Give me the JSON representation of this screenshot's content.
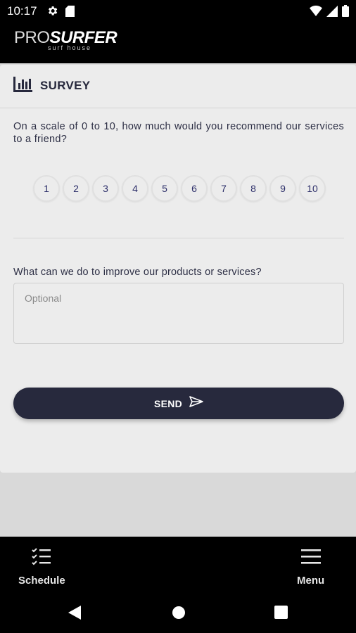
{
  "status_bar": {
    "time": "10:17",
    "icons_left": [
      "gear-icon",
      "sd-card-icon"
    ],
    "icons_right": [
      "wifi-icon",
      "signal-icon",
      "battery-icon"
    ]
  },
  "header": {
    "logo_pro": "PRO",
    "logo_surfer": "SURFER",
    "logo_sub": "surf house"
  },
  "survey": {
    "title": "SURVEY",
    "question": "On a scale of 0 to 10, how much would you recommend our services to a friend?",
    "scale": [
      "1",
      "2",
      "3",
      "4",
      "5",
      "6",
      "7",
      "8",
      "9",
      "10"
    ],
    "improve_label": "What can we do to improve our products or services?",
    "improve_placeholder": "Optional",
    "send_label": "SEND"
  },
  "bottom_nav": {
    "schedule_label": "Schedule",
    "menu_label": "Menu"
  },
  "colors": {
    "accent": "#27293d",
    "card": "#ececec",
    "background": "#d9d9d9"
  }
}
